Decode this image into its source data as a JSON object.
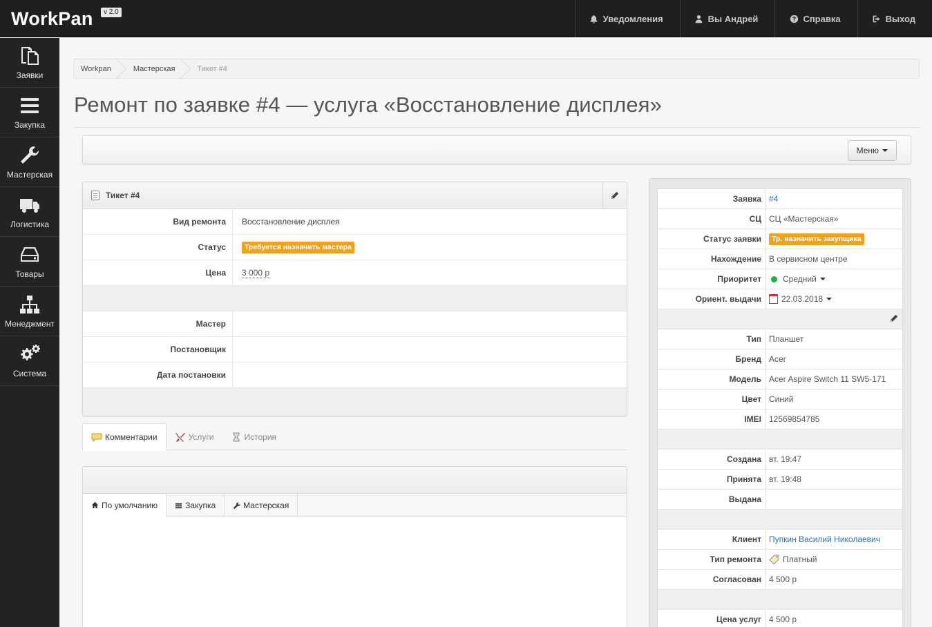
{
  "brand": {
    "name": "WorkPan",
    "version": "v 2.0"
  },
  "topnav": [
    {
      "label": "Уведомления",
      "icon": "bell-icon"
    },
    {
      "label": "Вы Андрей",
      "icon": "user-icon"
    },
    {
      "label": "Справка",
      "icon": "question-icon"
    },
    {
      "label": "Выход",
      "icon": "logout-icon"
    }
  ],
  "sidebar": [
    {
      "label": "Заявки",
      "icon": "documents-icon"
    },
    {
      "label": "Закупка",
      "icon": "bars-icon"
    },
    {
      "label": "Мастерская",
      "icon": "wrench-icon"
    },
    {
      "label": "Логистика",
      "icon": "truck-icon"
    },
    {
      "label": "Товары",
      "icon": "hdd-icon"
    },
    {
      "label": "Менеджмент",
      "icon": "sitemap-icon"
    },
    {
      "label": "Система",
      "icon": "gears-icon"
    }
  ],
  "breadcrumb": [
    "Workpan",
    "Мастерская",
    "Тикет #4"
  ],
  "page_title": "Ремонт по заявке #4 — услуга «Восстановление дисплея»",
  "toolbar": {
    "menu_label": "Меню"
  },
  "ticket": {
    "title": "Тикет #4",
    "rows": {
      "repair_type": {
        "label": "Вид ремонта",
        "value": "Восстановление дисплея"
      },
      "status": {
        "label": "Статус",
        "value": "Требуется назначить мастера"
      },
      "price": {
        "label": "Цена",
        "value": "3 000 р"
      },
      "master": {
        "label": "Мастер",
        "value": ""
      },
      "assigner": {
        "label": "Постановщик",
        "value": ""
      },
      "assign_date": {
        "label": "Дата постановки",
        "value": ""
      }
    }
  },
  "tabs": [
    {
      "label": "Комментарии",
      "icon": "comment-icon"
    },
    {
      "label": "Услуги",
      "icon": "tools-icon"
    },
    {
      "label": "История",
      "icon": "hourglass-icon"
    }
  ],
  "subtabs": [
    {
      "label": "По умолчанию",
      "icon": "home-icon"
    },
    {
      "label": "Закупка",
      "icon": "bars-icon"
    },
    {
      "label": "Мастерская",
      "icon": "wrench-icon"
    }
  ],
  "details": {
    "order": {
      "label": "Заявка",
      "value": "#4"
    },
    "sc": {
      "label": "СЦ",
      "value": "СЦ «Мастерская»"
    },
    "order_status": {
      "label": "Статус заявки",
      "value": "Тр. назначить закупщика"
    },
    "location": {
      "label": "Нахождение",
      "value": "В сервисном центре"
    },
    "priority": {
      "label": "Приоритет",
      "value": "Средний"
    },
    "due": {
      "label": "Ориент. выдачи",
      "value": "22.03.2018"
    },
    "type": {
      "label": "Тип",
      "value": "Планшет"
    },
    "brand": {
      "label": "Бренд",
      "value": "Acer"
    },
    "model": {
      "label": "Модель",
      "value": "Acer Aspire Switch 11 SW5-171"
    },
    "color": {
      "label": "Цвет",
      "value": "Синий"
    },
    "imei": {
      "label": "IMEI",
      "value": "12569854785"
    },
    "created": {
      "label": "Создана",
      "value": "вт. 19:47"
    },
    "accepted": {
      "label": "Принята",
      "value": "вт. 19:48"
    },
    "issued": {
      "label": "Выдана",
      "value": ""
    },
    "client": {
      "label": "Клиент",
      "value": "Пупкин Василий Николаевич"
    },
    "repair_kind": {
      "label": "Тип ремонта",
      "value": "Платный"
    },
    "agreed": {
      "label": "Согласован",
      "value": "4 500 р"
    },
    "services_price": {
      "label": "Цена услуг",
      "value": "4 500 р"
    }
  },
  "colors": {
    "accent_badge": "#f0a21b",
    "link": "#2a6fb0",
    "priority_dot": "#1fb33a"
  }
}
